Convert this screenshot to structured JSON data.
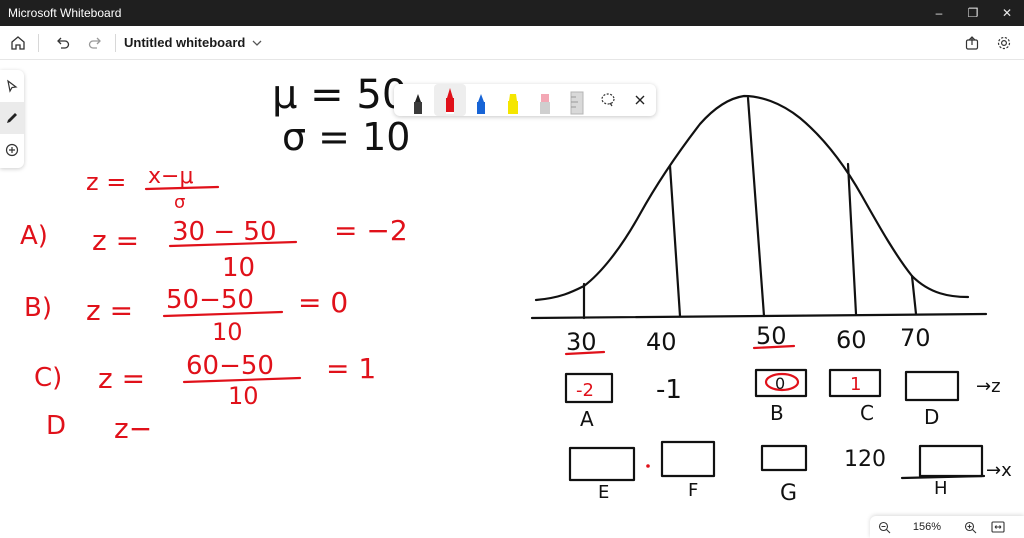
{
  "window": {
    "title": "Microsoft Whiteboard",
    "controls": [
      "–",
      "❐",
      "✕"
    ]
  },
  "appbar": {
    "doc_title": "Untitled whiteboard"
  },
  "zoom": {
    "level": "156%"
  },
  "board": {
    "params": {
      "mu": "μ = 50",
      "sigma": "σ = 10"
    },
    "formula": {
      "lhs": "z =",
      "num": "x−μ",
      "den": "σ"
    },
    "steps": [
      {
        "label": "A)",
        "lhs": "z =",
        "num": "30 − 50",
        "den": "10",
        "result": "= −2"
      },
      {
        "label": "B)",
        "lhs": "z =",
        "num": "50−50",
        "den": "10",
        "result": "= 0"
      },
      {
        "label": "C)",
        "lhs": "z =",
        "num": "60−50",
        "den": "10",
        "result": "= 1"
      },
      {
        "label": "D",
        "lhs": "z−"
      }
    ],
    "axis_ticks": [
      "30",
      "40",
      "50",
      "60",
      "70"
    ],
    "z_boxes": [
      {
        "value": "-2",
        "label": "A"
      },
      {
        "value": "-1",
        "label": ""
      },
      {
        "value": "0",
        "label": "B"
      },
      {
        "value": "1",
        "label": "C"
      },
      {
        "value": "",
        "label": "D"
      }
    ],
    "z_arrow": "→z",
    "x_boxes": [
      {
        "value": "",
        "label": "E"
      },
      {
        "value": "",
        "label": "F"
      },
      {
        "value": "",
        "label": "G"
      },
      {
        "value": "120",
        "label": ""
      },
      {
        "value": "",
        "label": "H"
      }
    ],
    "x_arrow": "→x"
  }
}
